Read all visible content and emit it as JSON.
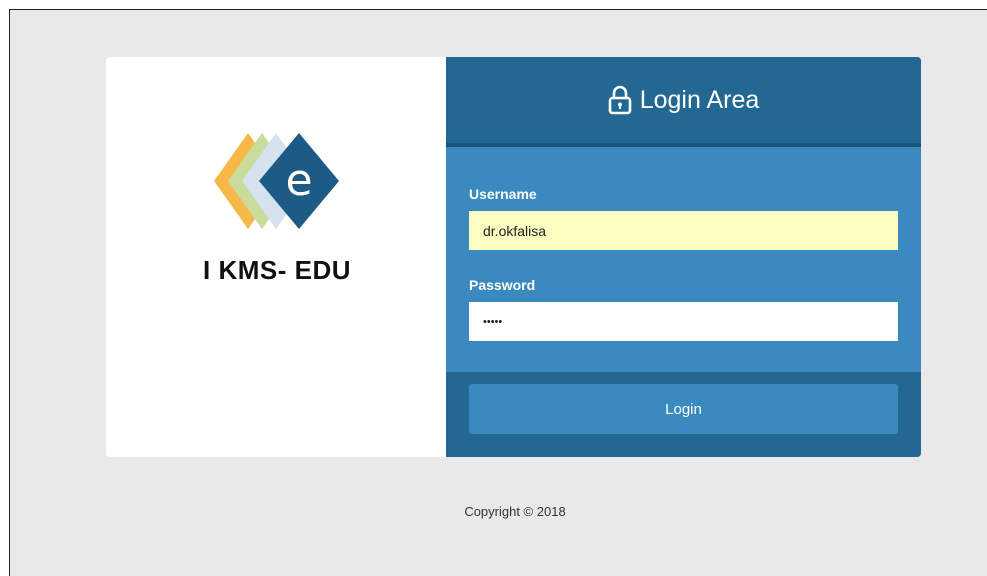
{
  "brand": {
    "logo_letter": "e",
    "name": "I KMS- EDU"
  },
  "form": {
    "header_title": "Login Area",
    "header_icon": "lock-icon",
    "username_label": "Username",
    "username_value": "dr.okfalisa",
    "password_label": "Password",
    "password_masked": "•••••",
    "login_label": "Login"
  },
  "footer": {
    "copyright": "Copyright © 2018"
  },
  "colors": {
    "page_background": "#e9e9e9",
    "header_blue": "#226893",
    "panel_blue": "#3b8abf",
    "autofill_yellow": "#fbfdc1",
    "logo_orange": "#f7b84a",
    "logo_green": "#c9dc9c",
    "logo_light_blue": "#d4e3ee",
    "logo_dark_blue": "#1d5b86"
  }
}
